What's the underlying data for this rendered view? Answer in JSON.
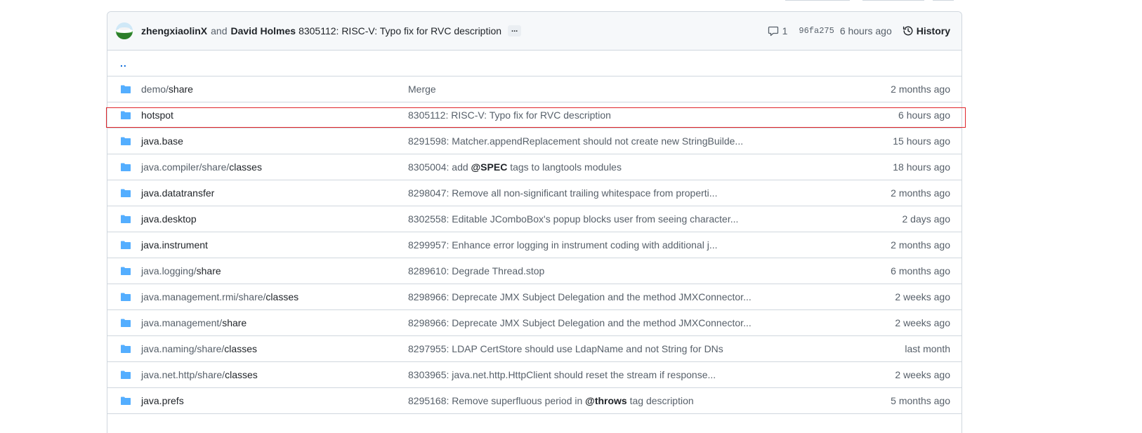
{
  "commit": {
    "authors": [
      "zhengxiaolinX",
      "David Holmes"
    ],
    "and_text": "and",
    "message": "8305112: RISC-V: Typo fix for RVC description",
    "ellipsis": "...",
    "comments": "1",
    "sha": "96fa275",
    "time": "6 hours ago",
    "history_label": "History"
  },
  "parent_link": "..",
  "rows": [
    {
      "name_prefix": "demo/",
      "name_last": "share",
      "msg_pre": "Merge",
      "msg_bold": "",
      "msg_post": "",
      "age": "2 months ago"
    },
    {
      "name_prefix": "",
      "name_last": "hotspot",
      "msg_pre": "8305112: RISC-V: Typo fix for RVC description",
      "msg_bold": "",
      "msg_post": "",
      "age": "6 hours ago"
    },
    {
      "name_prefix": "",
      "name_last": "java.base",
      "msg_pre": "8291598: Matcher.appendReplacement should not create new StringBuilde...",
      "msg_bold": "",
      "msg_post": "",
      "age": "15 hours ago"
    },
    {
      "name_prefix": "java.compiler/share/",
      "name_last": "classes",
      "msg_pre": "8305004: add ",
      "msg_bold": "@SPEC",
      "msg_post": " tags to langtools modules",
      "age": "18 hours ago"
    },
    {
      "name_prefix": "",
      "name_last": "java.datatransfer",
      "msg_pre": "8298047: Remove all non-significant trailing whitespace from properti...",
      "msg_bold": "",
      "msg_post": "",
      "age": "2 months ago"
    },
    {
      "name_prefix": "",
      "name_last": "java.desktop",
      "msg_pre": "8302558: Editable JComboBox's popup blocks user from seeing character...",
      "msg_bold": "",
      "msg_post": "",
      "age": "2 days ago"
    },
    {
      "name_prefix": "",
      "name_last": "java.instrument",
      "msg_pre": "8299957: Enhance error logging in instrument coding with additional j...",
      "msg_bold": "",
      "msg_post": "",
      "age": "2 months ago"
    },
    {
      "name_prefix": "java.logging/",
      "name_last": "share",
      "msg_pre": "8289610: Degrade Thread.stop",
      "msg_bold": "",
      "msg_post": "",
      "age": "6 months ago"
    },
    {
      "name_prefix": "java.management.rmi/share/",
      "name_last": "classes",
      "msg_pre": "8298966: Deprecate JMX Subject Delegation and the method JMXConnector...",
      "msg_bold": "",
      "msg_post": "",
      "age": "2 weeks ago"
    },
    {
      "name_prefix": "java.management/",
      "name_last": "share",
      "msg_pre": "8298966: Deprecate JMX Subject Delegation and the method JMXConnector...",
      "msg_bold": "",
      "msg_post": "",
      "age": "2 weeks ago"
    },
    {
      "name_prefix": "java.naming/share/",
      "name_last": "classes",
      "msg_pre": "8297955: LDAP CertStore should use LdapName and not String for DNs",
      "msg_bold": "",
      "msg_post": "",
      "age": "last month"
    },
    {
      "name_prefix": "java.net.http/share/",
      "name_last": "classes",
      "msg_pre": "8303965: java.net.http.HttpClient should reset the stream if response...",
      "msg_bold": "",
      "msg_post": "",
      "age": "2 weeks ago"
    },
    {
      "name_prefix": "",
      "name_last": "java.prefs",
      "msg_pre": "8295168: Remove superfluous period in ",
      "msg_bold": "@throws",
      "msg_post": " tag description",
      "age": "5 months ago"
    },
    {
      "name_prefix": "",
      "name_last": "",
      "msg_pre": "",
      "msg_bold": "",
      "msg_post": "",
      "age": ""
    }
  ],
  "colors": {
    "folder": "#54aeff",
    "link": "#0969da",
    "highlight": "#e0262b",
    "border": "#d0d7de"
  },
  "icons": [
    "folder-icon",
    "comment-icon",
    "history-icon"
  ]
}
